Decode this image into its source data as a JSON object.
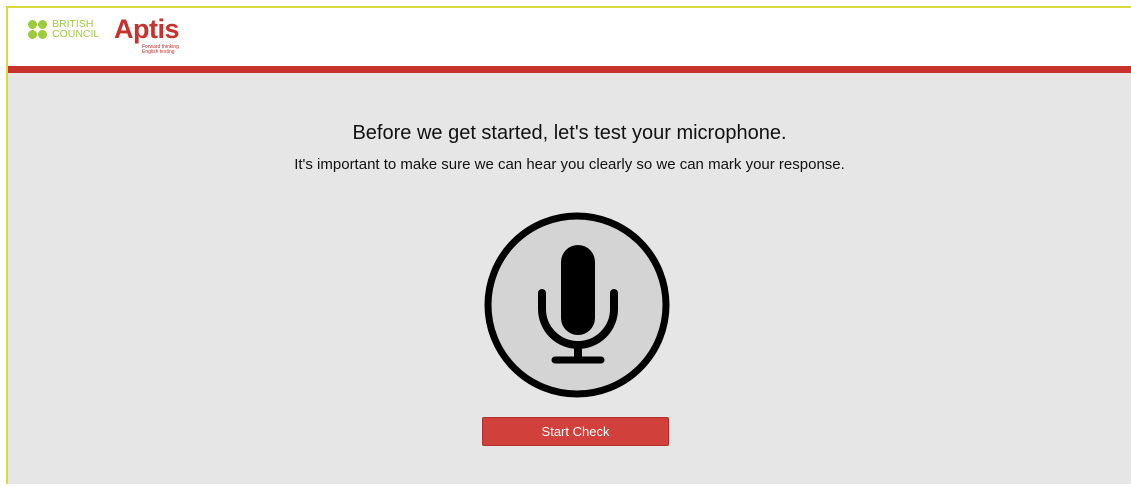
{
  "header": {
    "british_council_line1": "BRITISH",
    "british_council_line2": "COUNCIL",
    "aptis": "Aptis",
    "aptis_tagline": "Forward thinking English testing"
  },
  "main": {
    "title": "Before we get started, let's test your microphone.",
    "subtitle": "It's important to make sure we can hear you clearly so we can mark your response.",
    "start_button_label": "Start Check",
    "microphone_icon": "microphone-icon"
  },
  "colors": {
    "brand_red": "#c8322d",
    "british_council_green": "#9ccb3b",
    "background": "#e6e6e6",
    "button": "#d2403b"
  }
}
